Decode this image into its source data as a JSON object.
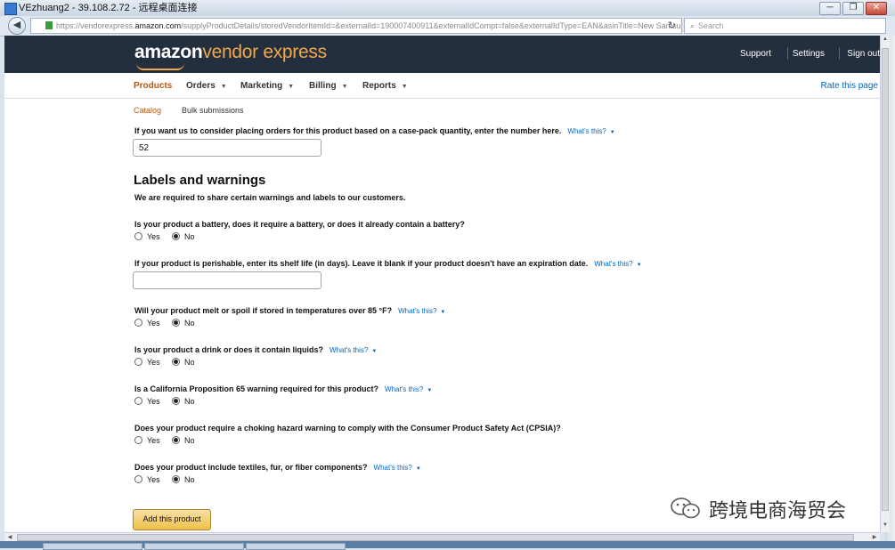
{
  "window": {
    "title": "VEzhuang2 - 39.108.2.72 - 远程桌面连接",
    "minimize": "─",
    "restore": "❐",
    "close": "✕"
  },
  "browser": {
    "back_icon": "back-arrow-icon",
    "url_prefix": "https://vendorexpress.",
    "url_domain": "amazon.com",
    "url_rest": "/supplyProductDetails/storedVendorItemId=&externalId=190007400911&externalIdCompt=false&externalIdType=EAN&asinTitle=New Samsung G…",
    "search_placeholder": "Search"
  },
  "header": {
    "logo_amazon": "amazon",
    "logo_vendor_express": "vendor express",
    "links": [
      "Support",
      "Settings",
      "Sign out"
    ]
  },
  "subnav": {
    "items": [
      {
        "label": "Products",
        "active": true,
        "dropdown": false
      },
      {
        "label": "Orders",
        "active": false,
        "dropdown": true
      },
      {
        "label": "Marketing",
        "active": false,
        "dropdown": true
      },
      {
        "label": "Billing",
        "active": false,
        "dropdown": true
      },
      {
        "label": "Reports",
        "active": false,
        "dropdown": true
      }
    ],
    "caret": "▼",
    "rate_link": "Rate this page"
  },
  "breadcrumb": {
    "catalog": "Catalog",
    "bulk": "Bulk submissions"
  },
  "case_pack": {
    "question": "If you want us to consider placing orders for this product based on a case-pack quantity, enter the number here.",
    "whats_this": "What's this?",
    "value": "52"
  },
  "labels_section": {
    "title": "Labels and warnings",
    "subtitle": "We are required to share certain warnings and labels to our customers."
  },
  "questions": {
    "battery": {
      "text": "Is your product a battery, does it require a battery, or does it already contain a battery?",
      "selected": "No"
    },
    "shelf_life": {
      "text": "If your product is perishable, enter its shelf life (in days). Leave it blank if your product doesn't have an expiration date.",
      "whats_this": "What's this?",
      "value": ""
    },
    "melt": {
      "text": "Will your product melt or spoil if stored in temperatures over 85 °F?",
      "whats_this": "What's this?",
      "selected": "No"
    },
    "liquid": {
      "text": "Is your product a drink or does it contain liquids?",
      "whats_this": "What's this?",
      "selected": "No"
    },
    "prop65": {
      "text": "Is a California Proposition 65 warning required for this product?",
      "whats_this": "What's this?",
      "selected": "No"
    },
    "choking": {
      "text": "Does your product require a choking hazard warning to comply with the Consumer Product Safety Act (CPSIA)?",
      "selected": "No"
    },
    "textiles": {
      "text": "Does your product include textiles, fur, or fiber components?",
      "whats_this": "What's this?",
      "selected": "No"
    }
  },
  "radio_labels": {
    "yes": "Yes",
    "no": "No"
  },
  "actions": {
    "add_product": "Add this product"
  },
  "watermark": {
    "text": "跨境电商海贸会",
    "icon": "wechat-icon"
  },
  "colors": {
    "header_bg": "#232f3e",
    "accent_orange": "#c45500",
    "logo_orange": "#f3a847",
    "link_blue": "#0066c0",
    "button_yellow": "#f0c14b"
  }
}
